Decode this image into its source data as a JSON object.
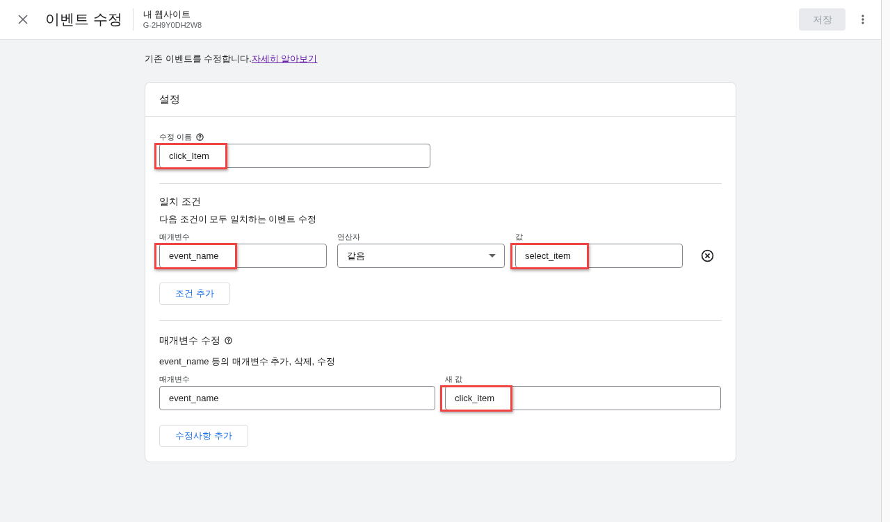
{
  "header": {
    "title": "이벤트 수정",
    "property_name": "내 웹사이트",
    "property_id": "G-2H9Y0DH2W8",
    "save_button": {
      "label": "저장",
      "disabled": true
    }
  },
  "intro": {
    "text": "기존 이벤트를 수정합니다.",
    "link": {
      "label": "자세히 알아보기",
      "visited": true
    }
  },
  "settings_card": {
    "title": "설정",
    "modification_name": {
      "label": "수정 이름",
      "value": "click_Item",
      "highlighted": true
    },
    "matching_conditions": {
      "title": "일치 조건",
      "description": "다음 조건이 모두 일치하는 이벤트 수정",
      "conditions": [
        {
          "parameter": {
            "label": "매개변수",
            "value": "event_name",
            "highlighted": true
          },
          "operator": {
            "label": "연산자",
            "value": "같음",
            "highlighted": false
          },
          "value": {
            "label": "값",
            "value": "select_item",
            "highlighted": true
          }
        }
      ],
      "add_button": "조건 추가"
    },
    "parameter_modifications": {
      "title": "매개변수 수정",
      "description": "event_name 등의 매개변수 추가, 삭제, 수정",
      "modifications": [
        {
          "parameter": {
            "label": "매개변수",
            "value": "event_name",
            "highlighted": false
          },
          "new_value": {
            "label": "새 값",
            "value": "click_item",
            "highlighted": true
          }
        }
      ],
      "add_button": "수정사항 추가"
    }
  }
}
